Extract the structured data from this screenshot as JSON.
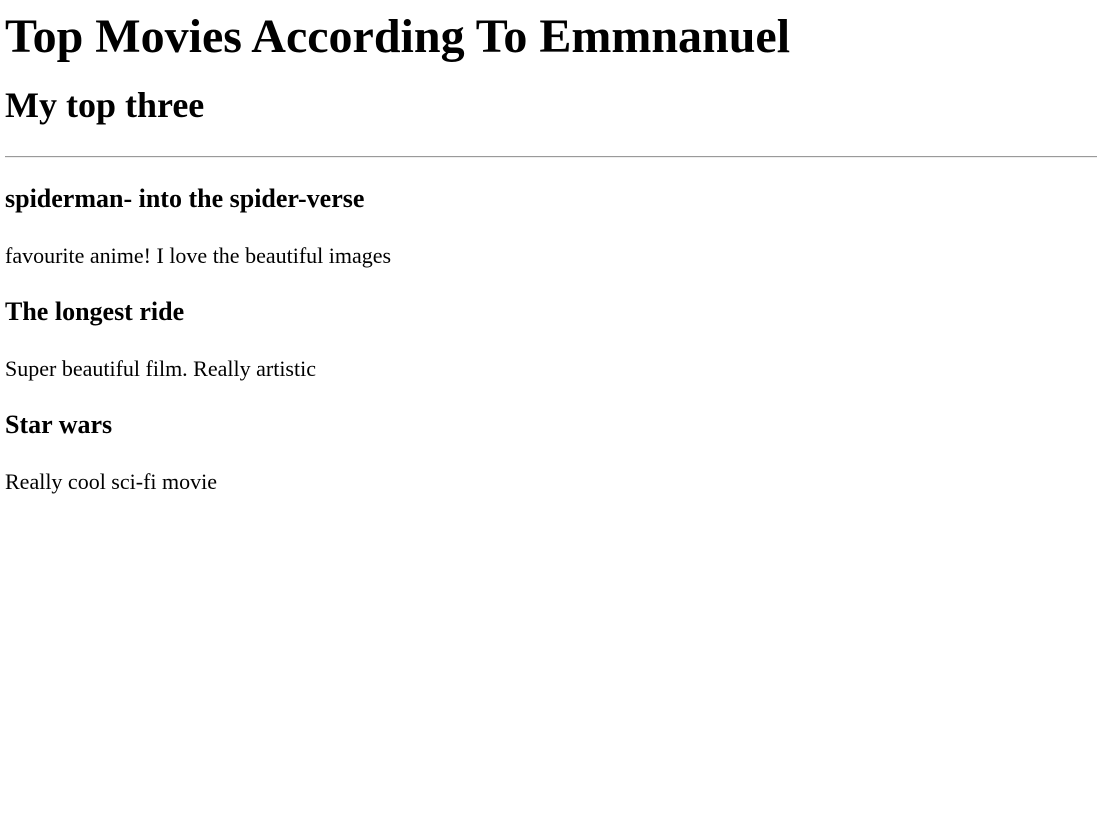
{
  "page": {
    "title": "Top Movies According To Emmnanuel",
    "subtitle": "My top three"
  },
  "movies": [
    {
      "title": "spiderman- into the spider-verse",
      "description": "favourite anime! I love the beautiful images"
    },
    {
      "title": "The longest ride",
      "description": "Super beautiful film. Really artistic"
    },
    {
      "title": "Star wars",
      "description": "Really cool sci-fi movie"
    }
  ]
}
